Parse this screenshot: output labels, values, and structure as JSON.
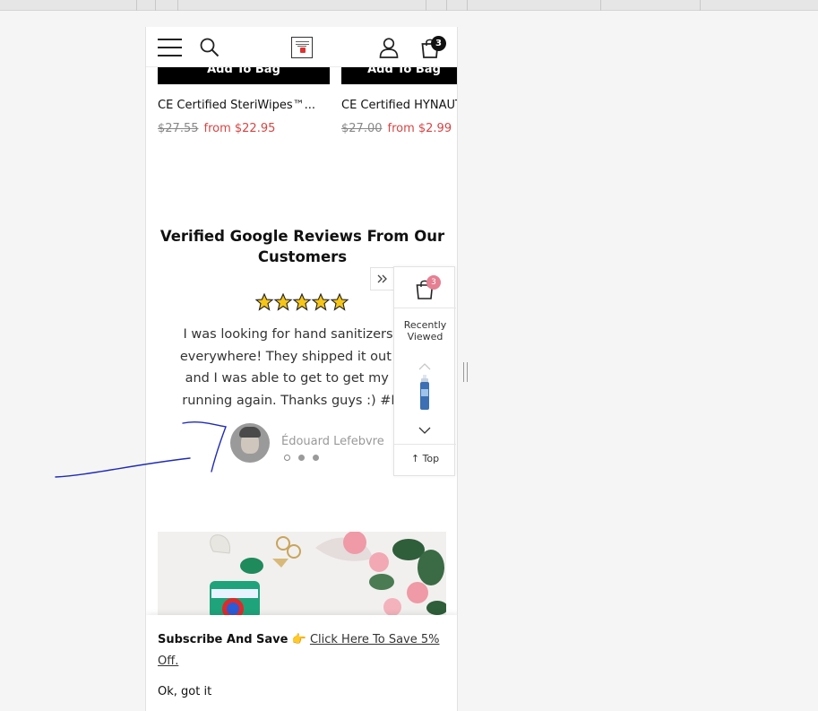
{
  "header": {
    "menu_icon": "hamburger-menu-icon",
    "search_icon": "search-icon",
    "logo_icon": "store-logo",
    "account_icon": "user-icon",
    "cart_icon": "shopping-bag-icon",
    "cart_count": "3"
  },
  "products": [
    {
      "add_label": "Add To Bag",
      "name": "CE Certified SteriWipes™...",
      "old_price": "$27.55",
      "new_price": "from $22.95"
    },
    {
      "add_label": "Add To Bag",
      "name": "CE Certified HYNAUT",
      "old_price": "$27.00",
      "new_price": "from $2.99"
    }
  ],
  "reviews": {
    "title": "Verified Google Reviews From Our Customers",
    "rating": 5,
    "text_lines": [
      "I was looking for hand sanitizers and",
      "everywhere! They shipped it out in or",
      "and I was able to get to get my busi",
      "running again. Thanks guys :) #LifeS"
    ],
    "reviewer": "Édouard Lefebvre",
    "dots": 3,
    "active_dot": 0
  },
  "widget": {
    "cart_count": "3",
    "recently_viewed_line1": "Recently",
    "recently_viewed_line2": "Viewed",
    "top_label": "Top",
    "up_icon": "chevron-up-icon",
    "down_icon": "chevron-down-icon",
    "collapse_icon": "double-chevron-right-icon"
  },
  "subscribe": {
    "bold": "Subscribe And Save",
    "emoji": "👉",
    "link": "Click Here To Save 5% Off.",
    "dismiss": "Ok, got it"
  },
  "colors": {
    "sale_price": "#d64545",
    "cart_badge": "#111111",
    "widget_badge": "#e57f92",
    "star_fill": "#f5c518",
    "annotation_ink": "#1f2bb8"
  }
}
